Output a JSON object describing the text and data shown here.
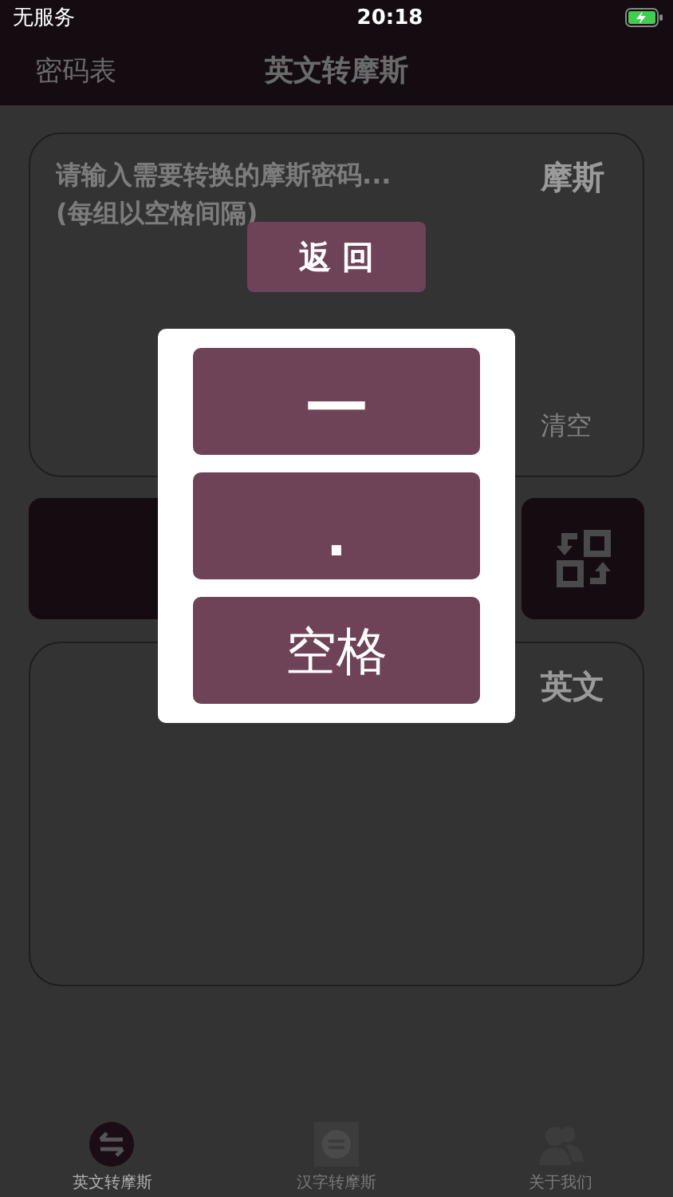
{
  "status_bar": {
    "carrier": "无服务",
    "time": "20:18"
  },
  "nav": {
    "left_link": "密码表",
    "title": "英文转摩斯"
  },
  "input_card": {
    "placeholder": "请输入需要转换的摩斯密码...\n(每组以空格间隔)",
    "label": "摩斯",
    "clear": "清空"
  },
  "output_card": {
    "label": "英文"
  },
  "modal": {
    "back_button": "返 回",
    "keys": [
      {
        "kind": "dash",
        "label": "—"
      },
      {
        "kind": "dot",
        "label": "."
      },
      {
        "kind": "space",
        "label": "空格"
      }
    ]
  },
  "tab_bar": [
    {
      "label": "英文转摩斯",
      "selected": true
    },
    {
      "label": "汉字转摩斯",
      "selected": false
    },
    {
      "label": "关于我们",
      "selected": false
    }
  ]
}
